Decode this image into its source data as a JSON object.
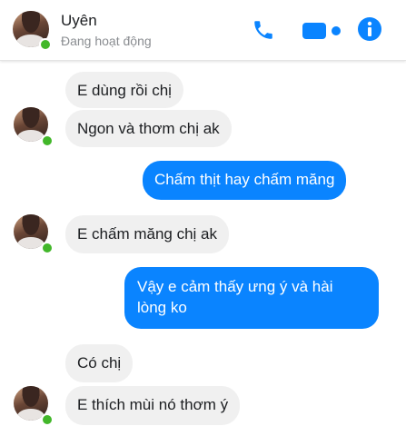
{
  "header": {
    "contact_name": "Uyên",
    "status": "Đang hoạt động",
    "icons": [
      "phone-icon",
      "video-camera-icon",
      "info-icon"
    ],
    "accent_color": "#0a84ff",
    "online_color": "#42b72a"
  },
  "messages": [
    {
      "side": "in",
      "text": "E dùng rồi chị"
    },
    {
      "side": "in",
      "text": "Ngon và thơm chị ak"
    },
    {
      "side": "out",
      "text": "Chấm thịt hay chấm măng"
    },
    {
      "side": "in",
      "text": "E chấm măng chị ak"
    },
    {
      "side": "out",
      "text": "Vậy e cảm thấy ưng ý và hài",
      "text2": "lòng ko"
    },
    {
      "side": "in",
      "text": "Có chị"
    },
    {
      "side": "in",
      "text": "E thích mùi nó thơm ý"
    }
  ]
}
